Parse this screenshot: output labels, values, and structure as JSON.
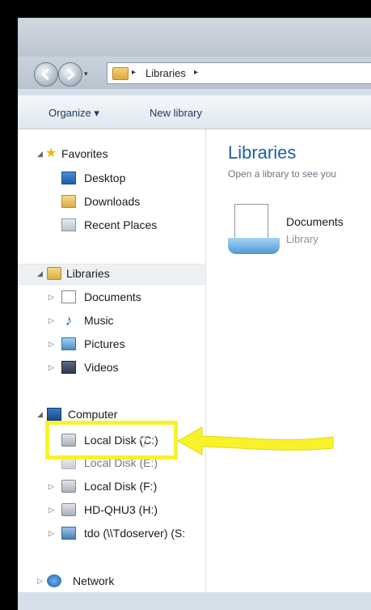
{
  "address": {
    "crumbs": [
      "Libraries"
    ]
  },
  "toolbar": {
    "organize_label": "Organize",
    "organize_arrow": "▾",
    "new_library_label": "New library"
  },
  "nav": {
    "favorites": {
      "label": "Favorites",
      "items": [
        "Desktop",
        "Downloads",
        "Recent Places"
      ]
    },
    "libraries": {
      "label": "Libraries",
      "items": [
        "Documents",
        "Music",
        "Pictures",
        "Videos"
      ]
    },
    "computer": {
      "label": "Computer",
      "items": [
        "Local Disk (C:)",
        "Local Disk (E:)",
        "Local Disk (F:)",
        "HD-QHU3 (H:)",
        "tdo (\\\\Tdoserver) (S:"
      ]
    },
    "network": {
      "label": "Network"
    }
  },
  "content": {
    "title": "Libraries",
    "subtitle": "Open a library to see you",
    "libraries": [
      {
        "name": "Documents",
        "type": "Library"
      }
    ]
  },
  "annotation": {
    "highlight_color": "#f7f22a",
    "arrow_color": "#f7f22a"
  },
  "colors": {
    "title_blue": "#1e5ea6",
    "toolbar_text": "#1e3a5f"
  },
  "icons": {
    "back": "back-arrow-icon",
    "forward": "forward-arrow-icon",
    "star": "star-icon",
    "disk": "hard-disk-icon",
    "network": "network-icon"
  }
}
